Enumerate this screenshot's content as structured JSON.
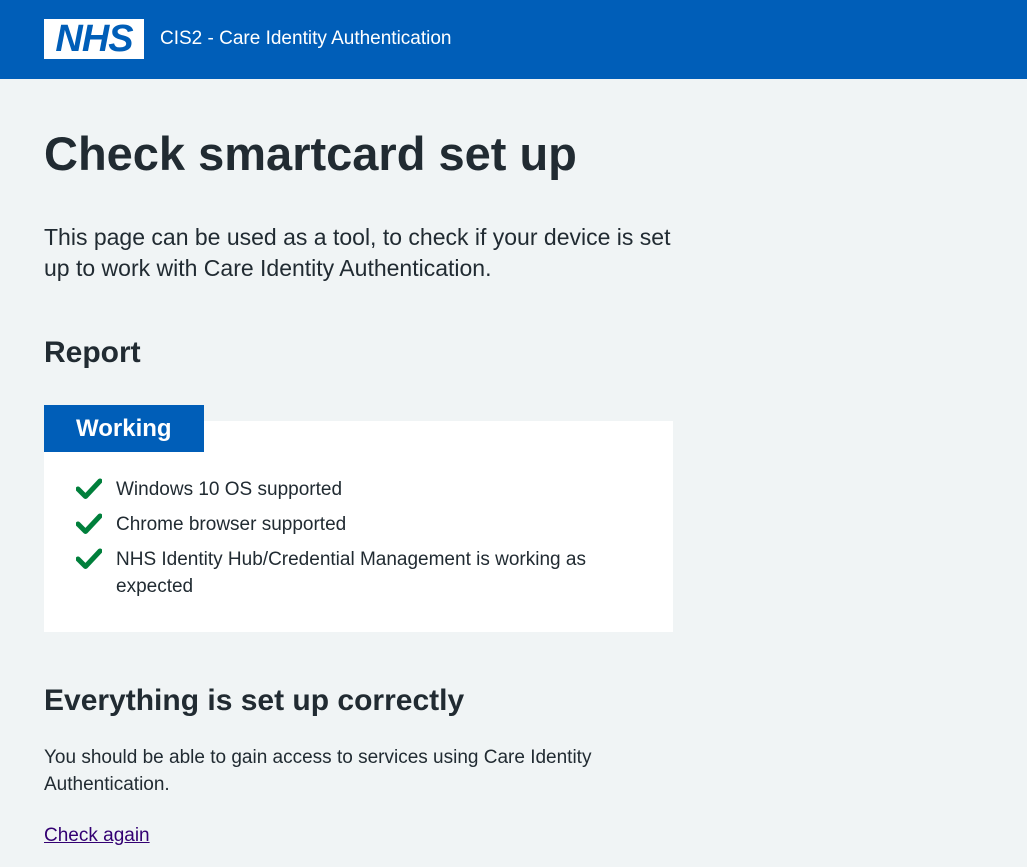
{
  "header": {
    "logo_text": "NHS",
    "service_name": "CIS2 - Care Identity Authentication",
    "brand_color": "#005eb8"
  },
  "main": {
    "title": "Check smartcard set up",
    "intro": "This page can be used as a tool, to check if your device is set up to work with Care Identity Authentication.",
    "report_heading": "Report",
    "report": {
      "status_label": "Working",
      "items": [
        {
          "icon": "tick-icon",
          "text": "Windows 10 OS supported"
        },
        {
          "icon": "tick-icon",
          "text": "Chrome browser supported"
        },
        {
          "icon": "tick-icon",
          "text": "NHS Identity Hub/Credential Management is working as expected"
        }
      ],
      "tick_color": "#007f3b"
    },
    "result_heading": "Everything is set up correctly",
    "result_body": "You should be able to gain access to services using Care Identity Authentication.",
    "check_again_link": "Check again",
    "link_color": "#330072"
  }
}
